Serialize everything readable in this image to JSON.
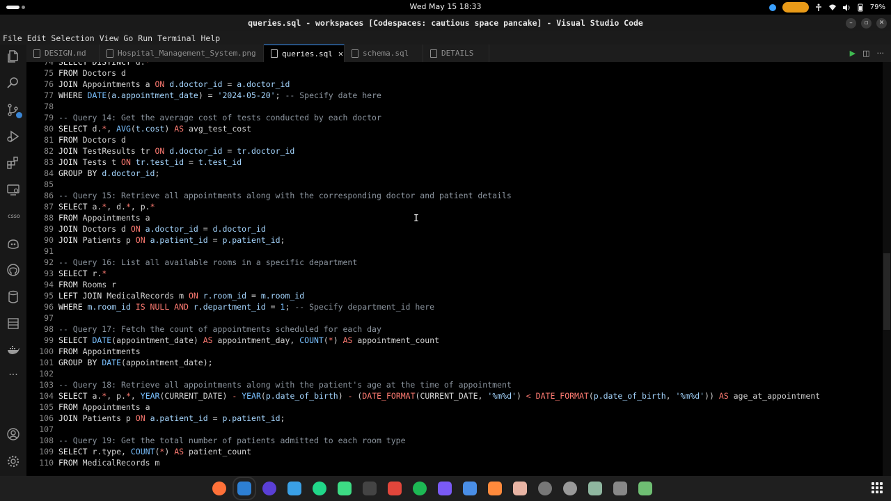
{
  "topbar": {
    "clock": "Wed May 15  18:33",
    "battery": "79%"
  },
  "window": {
    "title": "queries.sql - workspaces [Codespaces: cautious space pancake] - Visual Studio Code"
  },
  "menubar": [
    "File",
    "Edit",
    "Selection",
    "View",
    "Go",
    "Run",
    "Terminal",
    "Help"
  ],
  "activitybar": {
    "items": [
      "explorer-icon",
      "search-icon",
      "source-control-icon",
      "run-debug-icon",
      "extensions-icon",
      "remote-explorer-icon",
      "csso",
      "github-copilot-icon",
      "github-icon",
      "database-icon",
      "pages-icon",
      "docker-icon",
      "more-icon"
    ],
    "csso_label": "csso",
    "bottom": [
      "account-icon",
      "settings-gear-icon"
    ]
  },
  "tabs": [
    {
      "label": "DESIGN.md",
      "active": false
    },
    {
      "label": "Hospital_Management_System.png",
      "active": false
    },
    {
      "label": "queries.sql",
      "active": true
    },
    {
      "label": "schema.sql",
      "active": false
    },
    {
      "label": "DETAILS",
      "active": false
    }
  ],
  "editor": {
    "lines": [
      {
        "n": "74",
        "tokens": [
          [
            "kw2",
            "SELECT DISTINCT "
          ],
          [
            "",
            "d."
          ],
          [
            "op",
            "*"
          ]
        ]
      },
      {
        "n": "75",
        "tokens": [
          [
            "kw2",
            "FROM "
          ],
          [
            "",
            "Doctors d"
          ]
        ]
      },
      {
        "n": "76",
        "tokens": [
          [
            "kw2",
            "JOIN "
          ],
          [
            "",
            "Appointments a "
          ],
          [
            "kw",
            "ON "
          ],
          [
            "col",
            "d.doctor_id"
          ],
          [
            "",
            " = "
          ],
          [
            "col",
            "a.doctor_id"
          ]
        ]
      },
      {
        "n": "77",
        "tokens": [
          [
            "kw2",
            "WHERE "
          ],
          [
            "fn",
            "DATE"
          ],
          [
            "",
            "("
          ],
          [
            "col",
            "a.appointment_date"
          ],
          [
            "",
            ") = "
          ],
          [
            "str",
            "'2024-05-20'"
          ],
          [
            "",
            "; "
          ],
          [
            "cm",
            "-- Specify date here"
          ]
        ]
      },
      {
        "n": "78",
        "tokens": []
      },
      {
        "n": "79",
        "tokens": [
          [
            "cm",
            "-- Query 14: Get the average cost of tests conducted by each doctor"
          ]
        ]
      },
      {
        "n": "80",
        "tokens": [
          [
            "kw2",
            "SELECT "
          ],
          [
            "",
            "d."
          ],
          [
            "op",
            "*"
          ],
          [
            "",
            ", "
          ],
          [
            "fn",
            "AVG"
          ],
          [
            "",
            "("
          ],
          [
            "col",
            "t.cost"
          ],
          [
            "",
            ") "
          ],
          [
            "kw",
            "AS"
          ],
          [
            "",
            " avg_test_cost"
          ]
        ]
      },
      {
        "n": "81",
        "tokens": [
          [
            "kw2",
            "FROM "
          ],
          [
            "",
            "Doctors d"
          ]
        ]
      },
      {
        "n": "82",
        "tokens": [
          [
            "kw2",
            "JOIN "
          ],
          [
            "",
            "TestResults tr "
          ],
          [
            "kw",
            "ON "
          ],
          [
            "col",
            "d.doctor_id"
          ],
          [
            "",
            " = "
          ],
          [
            "col",
            "tr.doctor_id"
          ]
        ]
      },
      {
        "n": "83",
        "tokens": [
          [
            "kw2",
            "JOIN "
          ],
          [
            "",
            "Tests t "
          ],
          [
            "kw",
            "ON "
          ],
          [
            "col",
            "tr.test_id"
          ],
          [
            "",
            " = "
          ],
          [
            "col",
            "t.test_id"
          ]
        ]
      },
      {
        "n": "84",
        "tokens": [
          [
            "kw2",
            "GROUP BY "
          ],
          [
            "col",
            "d.doctor_id"
          ],
          [
            "",
            ";"
          ]
        ]
      },
      {
        "n": "85",
        "tokens": []
      },
      {
        "n": "86",
        "tokens": [
          [
            "cm",
            "-- Query 15: Retrieve all appointments along with the corresponding doctor and patient details"
          ]
        ]
      },
      {
        "n": "87",
        "tokens": [
          [
            "kw2",
            "SELECT "
          ],
          [
            "",
            "a."
          ],
          [
            "op",
            "*"
          ],
          [
            "",
            ", d."
          ],
          [
            "op",
            "*"
          ],
          [
            "",
            ", p."
          ],
          [
            "op",
            "*"
          ]
        ]
      },
      {
        "n": "88",
        "tokens": [
          [
            "kw2",
            "FROM "
          ],
          [
            "",
            "Appointments a"
          ]
        ]
      },
      {
        "n": "89",
        "tokens": [
          [
            "kw2",
            "JOIN "
          ],
          [
            "",
            "Doctors d "
          ],
          [
            "kw",
            "ON "
          ],
          [
            "col",
            "a.doctor_id"
          ],
          [
            "",
            " = "
          ],
          [
            "col",
            "d.doctor_id"
          ]
        ]
      },
      {
        "n": "90",
        "tokens": [
          [
            "kw2",
            "JOIN "
          ],
          [
            "",
            "Patients p "
          ],
          [
            "kw",
            "ON "
          ],
          [
            "col",
            "a.patient_id"
          ],
          [
            "",
            " = "
          ],
          [
            "col",
            "p.patient_id"
          ],
          [
            "",
            ";"
          ]
        ]
      },
      {
        "n": "91",
        "tokens": []
      },
      {
        "n": "92",
        "tokens": [
          [
            "cm",
            "-- Query 16: List all available rooms in a specific department"
          ]
        ]
      },
      {
        "n": "93",
        "tokens": [
          [
            "kw2",
            "SELECT "
          ],
          [
            "",
            "r."
          ],
          [
            "op",
            "*"
          ]
        ]
      },
      {
        "n": "94",
        "tokens": [
          [
            "kw2",
            "FROM "
          ],
          [
            "",
            "Rooms r"
          ]
        ]
      },
      {
        "n": "95",
        "tokens": [
          [
            "kw2",
            "LEFT JOIN "
          ],
          [
            "",
            "MedicalRecords m "
          ],
          [
            "kw",
            "ON "
          ],
          [
            "col",
            "r.room_id"
          ],
          [
            "",
            " = "
          ],
          [
            "col",
            "m.room_id"
          ]
        ]
      },
      {
        "n": "96",
        "tokens": [
          [
            "kw2",
            "WHERE "
          ],
          [
            "col",
            "m.room_id"
          ],
          [
            "kw",
            " IS NULL AND "
          ],
          [
            "col",
            "r.department_id"
          ],
          [
            "",
            " = "
          ],
          [
            "num",
            "1"
          ],
          [
            "",
            "; "
          ],
          [
            "cm",
            "-- Specify department_id here"
          ]
        ]
      },
      {
        "n": "97",
        "tokens": []
      },
      {
        "n": "98",
        "tokens": [
          [
            "cm",
            "-- Query 17: Fetch the count of appointments scheduled for each day"
          ]
        ]
      },
      {
        "n": "99",
        "tokens": [
          [
            "kw2",
            "SELECT "
          ],
          [
            "fn",
            "DATE"
          ],
          [
            "",
            "(appointment_date) "
          ],
          [
            "kw",
            "AS"
          ],
          [
            "",
            " appointment_day, "
          ],
          [
            "fn",
            "COUNT"
          ],
          [
            "",
            "("
          ],
          [
            "op",
            "*"
          ],
          [
            "",
            ") "
          ],
          [
            "kw",
            "AS"
          ],
          [
            "",
            " appointment_count"
          ]
        ]
      },
      {
        "n": "100",
        "tokens": [
          [
            "kw2",
            "FROM "
          ],
          [
            "",
            "Appointments"
          ]
        ]
      },
      {
        "n": "101",
        "tokens": [
          [
            "kw2",
            "GROUP BY "
          ],
          [
            "fn",
            "DATE"
          ],
          [
            "",
            "(appointment_date);"
          ]
        ]
      },
      {
        "n": "102",
        "tokens": []
      },
      {
        "n": "103",
        "tokens": [
          [
            "cm",
            "-- Query 18: Retrieve all appointments along with the patient's age at the time of appointment"
          ]
        ]
      },
      {
        "n": "104",
        "tokens": [
          [
            "kw2",
            "SELECT "
          ],
          [
            "",
            "a."
          ],
          [
            "op",
            "*"
          ],
          [
            "",
            ", p."
          ],
          [
            "op",
            "*"
          ],
          [
            "",
            ", "
          ],
          [
            "fn",
            "YEAR"
          ],
          [
            "",
            "(CURRENT_DATE) "
          ],
          [
            "op",
            "-"
          ],
          [
            "",
            " "
          ],
          [
            "fn",
            "YEAR"
          ],
          [
            "",
            "("
          ],
          [
            "col",
            "p.date_of_birth"
          ],
          [
            "",
            ") "
          ],
          [
            "op",
            "-"
          ],
          [
            "",
            " ("
          ],
          [
            "kw",
            "DATE_FORMAT"
          ],
          [
            "",
            "(CURRENT_DATE, "
          ],
          [
            "str",
            "'%m%d'"
          ],
          [
            "",
            ") "
          ],
          [
            "op",
            "<"
          ],
          [
            "",
            " "
          ],
          [
            "kw",
            "DATE_FORMAT"
          ],
          [
            "",
            "("
          ],
          [
            "col",
            "p.date_of_birth"
          ],
          [
            "",
            ", "
          ],
          [
            "str",
            "'%m%d'"
          ],
          [
            "",
            ")) "
          ],
          [
            "kw",
            "AS"
          ],
          [
            "",
            " age_at_appointment"
          ]
        ]
      },
      {
        "n": "105",
        "tokens": [
          [
            "kw2",
            "FROM "
          ],
          [
            "",
            "Appointments a"
          ]
        ]
      },
      {
        "n": "106",
        "tokens": [
          [
            "kw2",
            "JOIN "
          ],
          [
            "",
            "Patients p "
          ],
          [
            "kw",
            "ON "
          ],
          [
            "col",
            "a.patient_id"
          ],
          [
            "",
            " = "
          ],
          [
            "col",
            "p.patient_id"
          ],
          [
            "",
            ";"
          ]
        ]
      },
      {
        "n": "107",
        "tokens": []
      },
      {
        "n": "108",
        "tokens": [
          [
            "cm",
            "-- Query 19: Get the total number of patients admitted to each room type"
          ]
        ]
      },
      {
        "n": "109",
        "tokens": [
          [
            "kw2",
            "SELECT "
          ],
          [
            "",
            "r.type, "
          ],
          [
            "fn",
            "COUNT"
          ],
          [
            "",
            "("
          ],
          [
            "op",
            "*"
          ],
          [
            "",
            ") "
          ],
          [
            "kw",
            "AS"
          ],
          [
            "",
            " patient_count"
          ]
        ]
      },
      {
        "n": "110",
        "tokens": [
          [
            "kw2",
            "FROM "
          ],
          [
            "",
            "MedicalRecords m"
          ]
        ]
      }
    ]
  },
  "dock": {
    "apps": [
      "firefox",
      "vscode",
      "obs",
      "files-blue",
      "pycharm",
      "android-studio",
      "terminal",
      "scrcpy",
      "spotify",
      "hyper",
      "extensions",
      "sublime",
      "text-editor",
      "clock",
      "settings",
      "files",
      "trash-empty",
      "recycle"
    ]
  }
}
